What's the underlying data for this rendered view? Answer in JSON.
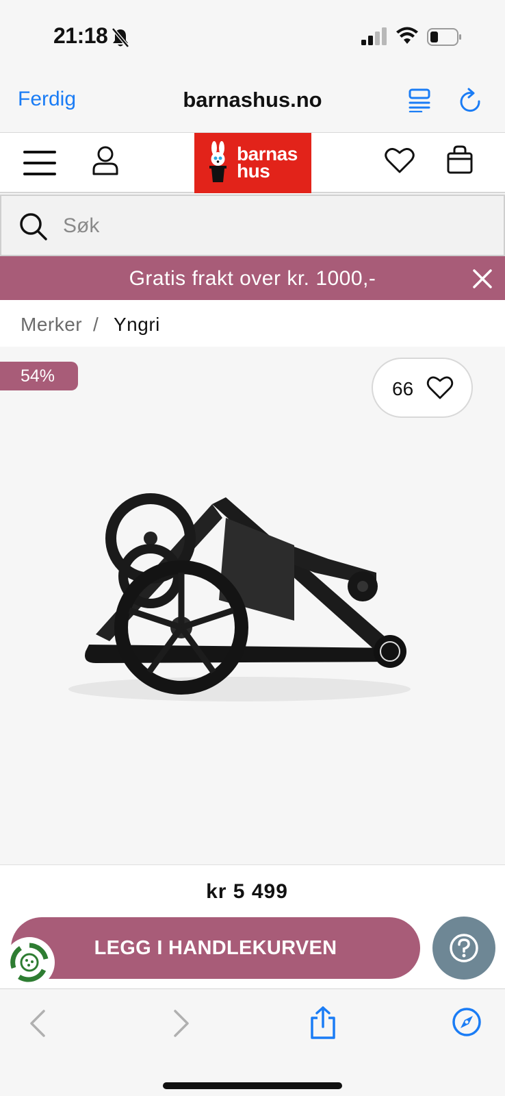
{
  "status_bar": {
    "time": "21:18",
    "icons": [
      "bell-slash-icon",
      "signal-icon",
      "wifi-icon",
      "battery-icon"
    ]
  },
  "safari": {
    "done_label": "Ferdig",
    "url": "barnashus.no",
    "accent_color": "#1a7cf5"
  },
  "site_header": {
    "logo_line1": "barnas",
    "logo_line2": "hus",
    "logo_color": "#e2231a"
  },
  "search": {
    "placeholder": "Søk",
    "value": ""
  },
  "promo": {
    "text": "Gratis frakt over kr. 1000,-",
    "color": "#a85c78"
  },
  "breadcrumb": {
    "items": [
      "Merker",
      "Yngri"
    ],
    "separator": "/"
  },
  "product": {
    "discount_badge": "54%",
    "favorite_count": "66",
    "image": "folded-stroller-photo"
  },
  "purchase": {
    "price": "kr 5 499",
    "add_to_cart_label": "LEGG I HANDLEKURVEN"
  }
}
